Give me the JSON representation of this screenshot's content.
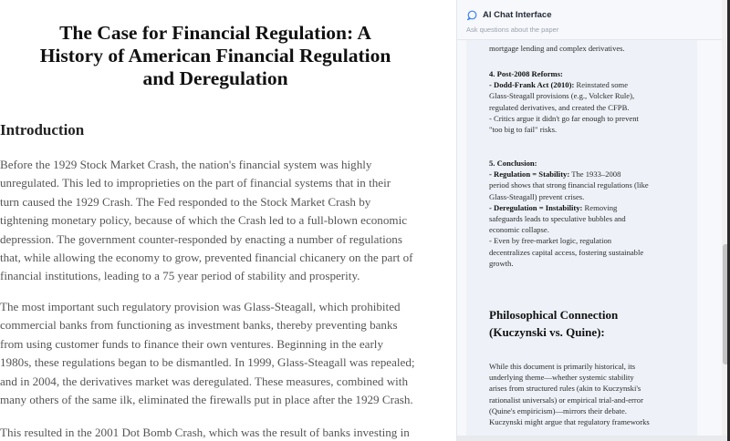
{
  "document": {
    "title_lines": [
      "The Case for Financial Regulation: A",
      "History of American Financial Regulation",
      "and Deregulation"
    ],
    "section_heading": "Introduction",
    "paragraphs": [
      [
        "Before the 1929 Stock Market Crash, the nation's financial system was highly",
        "unregulated. This led to improprieties on the part of financial systems that in their",
        "turn caused the 1929 Crash. The Fed responded to the Stock Market Crash by",
        "tightening monetary policy, because of which the Crash led to a full-blown economic",
        "depression. The government counter-responded by enacting a number of regulations",
        "that, while allowing the economy to grow, prevented financial chicanery on the part of",
        "financial institutions, leading to a 75 year period of stability and prosperity."
      ],
      [
        "The most important such regulatory provision was Glass-Steagall, which prohibited",
        "commercial banks from functioning as investment banks, thereby preventing banks",
        "from using customer funds to finance their own ventures. Beginning in the early",
        "1980s, these regulations began to be dismantled. In 1999, Glass-Steagall was repealed;",
        "and in 2004, the derivatives market was deregulated. These measures, combined with",
        "many others of the same ilk, eliminated the firewalls put in place after the 1929 Crash."
      ],
      [
        "This resulted in the 2001 Dot Bomb Crash, which was the result of banks investing in"
      ]
    ]
  },
  "chat": {
    "title": "AI Chat Interface",
    "subtitle": "Ask questions about the paper",
    "icon": "chat-bubble-icon",
    "message": {
      "top_fragment": "mortgage lending and complex derivatives.",
      "reforms": {
        "heading": "4. Post-2008 Reforms:",
        "lines": [
          {
            "bold": "- Dodd-Frank Act (2010):",
            "text": " Reinstated some"
          },
          {
            "bold": "",
            "text": "Glass-Steagall provisions (e.g., Volcker Rule),"
          },
          {
            "bold": "",
            "text": "regulated derivatives, and created the CFPB."
          },
          {
            "bold": "",
            "text": "- Critics argue it didn't go far enough to prevent"
          },
          {
            "bold": "",
            "text": "\"too big to fail\" risks."
          }
        ]
      },
      "conclusion": {
        "heading": "5. Conclusion:",
        "lines": [
          {
            "bold": "- Regulation = Stability:",
            "text": " The 1933–2008"
          },
          {
            "bold": "",
            "text": "period shows that strong financial regulations (like"
          },
          {
            "bold": "",
            "text": "Glass-Steagall) prevent crises."
          },
          {
            "bold": "- Deregulation = Instability:",
            "text": " Removing"
          },
          {
            "bold": "",
            "text": "safeguards leads to speculative bubbles and"
          },
          {
            "bold": "",
            "text": "economic collapse."
          },
          {
            "bold": "",
            "text": "- Even by free-market logic, regulation"
          },
          {
            "bold": "",
            "text": "decentralizes capital access, fostering sustainable"
          },
          {
            "bold": "",
            "text": "growth."
          }
        ]
      },
      "philosophy_heading_lines": [
        "Philosophical Connection",
        "(Kuczynski vs. Quine):"
      ],
      "philosophy_lines": [
        "While this document is primarily historical, its",
        "underlying theme—whether systemic stability",
        "arises from structured rules (akin to Kuczynski's",
        "rationalist universals) or empirical trial-and-error",
        "(Quine's empiricism)—mirrors their debate.",
        "Kuczynski might argue that regulatory frameworks"
      ]
    }
  },
  "colors": {
    "chat_panel_bg": "#f7f8fb",
    "message_bg": "#eef2f8",
    "scroll_thumb": "#c4c4c4"
  }
}
